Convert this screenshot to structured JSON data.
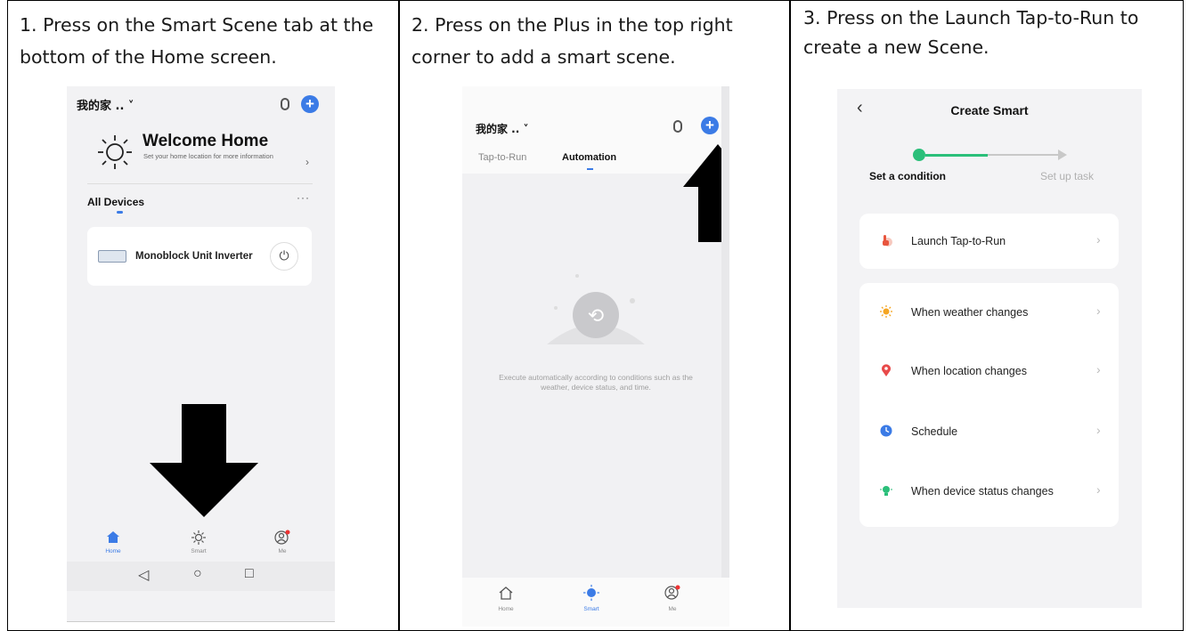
{
  "steps": [
    {
      "caption": "1. Press on the Smart Scene tab at the bottom of the Home screen."
    },
    {
      "caption": "2. Press on the Plus in the top right corner to add a smart scene."
    },
    {
      "caption": "3. Press on the Launch Tap-to-Run to create a new Scene."
    }
  ],
  "screen1": {
    "home_name": "我的家 .. ˅",
    "welcome_title": "Welcome Home",
    "welcome_sub": "Set your home location for more information",
    "section_title": "All Devices",
    "more_dots": "···",
    "device_name": "Monoblock Unit Inverter",
    "power_symbol": "⏻",
    "tabs": [
      "Home",
      "Smart",
      "Me"
    ],
    "nav": [
      "◁",
      "○",
      "□"
    ]
  },
  "screen2": {
    "home_name": "我的家 .. ˅",
    "tab_run": "Tap-to-Run",
    "tab_automation": "Automation",
    "empty_text": "Execute automatically according to conditions such as the weather, device status, and time.",
    "tabs": [
      "Home",
      "Smart",
      "Me"
    ]
  },
  "screen3": {
    "back": "‹",
    "title": "Create Smart",
    "step1": "Set a condition",
    "step2": "Set up task",
    "chevron": "›",
    "rows": [
      {
        "label": "Launch Tap-to-Run",
        "icon": "hand-icon",
        "color": "#e8553e"
      },
      {
        "label": "When weather changes",
        "icon": "sun-icon",
        "color": "#f5a623"
      },
      {
        "label": "When location changes",
        "icon": "location-pin-icon",
        "color": "#e84a4a"
      },
      {
        "label": "Schedule",
        "icon": "clock-icon",
        "color": "#3b7be6"
      },
      {
        "label": "When device status changes",
        "icon": "device-icon",
        "color": "#2bbf7a"
      }
    ]
  },
  "colors": {
    "accent_blue": "#3b7be6",
    "accent_green": "#2bbf7a",
    "arrow": "#000000"
  }
}
